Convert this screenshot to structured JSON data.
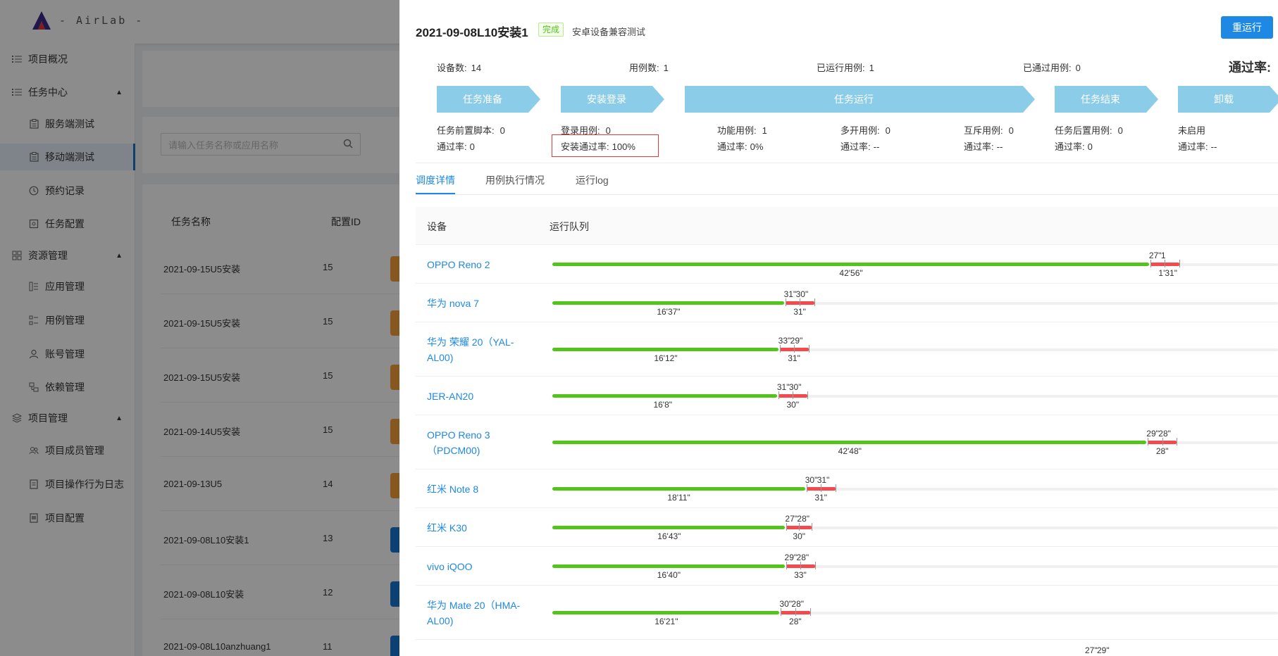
{
  "app": {
    "logo_text": "- AirLab -"
  },
  "sidebar": {
    "items": [
      {
        "label": "项目概况",
        "icon": "list-icon",
        "type": "group"
      },
      {
        "label": "任务中心",
        "icon": "list-icon",
        "type": "group",
        "expanded": true
      },
      {
        "label": "服务端测试",
        "icon": "clipboard-icon",
        "type": "sub"
      },
      {
        "label": "移动端测试",
        "icon": "clipboard-icon",
        "type": "sub",
        "active": true
      },
      {
        "label": "预约记录",
        "icon": "clock-icon",
        "type": "sub"
      },
      {
        "label": "任务配置",
        "icon": "config-icon",
        "type": "sub"
      },
      {
        "label": "资源管理",
        "icon": "grid-icon",
        "type": "group",
        "expanded": true
      },
      {
        "label": "应用管理",
        "icon": "app-icon",
        "type": "sub"
      },
      {
        "label": "用例管理",
        "icon": "case-icon",
        "type": "sub"
      },
      {
        "label": "账号管理",
        "icon": "user-icon",
        "type": "sub"
      },
      {
        "label": "依赖管理",
        "icon": "dependency-icon",
        "type": "sub"
      },
      {
        "label": "项目管理",
        "icon": "layers-icon",
        "type": "group",
        "expanded": true
      },
      {
        "label": "项目成员管理",
        "icon": "team-icon",
        "type": "sub"
      },
      {
        "label": "项目操作行为日志",
        "icon": "log-icon",
        "type": "sub"
      },
      {
        "label": "项目配置",
        "icon": "doc-icon",
        "type": "sub"
      }
    ]
  },
  "background": {
    "search_placeholder": "请输入任务名称或应用名称",
    "col_task_name": "任务名称",
    "col_config_id": "配置ID",
    "rows": [
      {
        "name": "2021-09-15U5安装",
        "config_id": "15"
      },
      {
        "name": "2021-09-15U5安装",
        "config_id": "15"
      },
      {
        "name": "2021-09-15U5安装",
        "config_id": "15"
      },
      {
        "name": "2021-09-14U5安装",
        "config_id": "15"
      },
      {
        "name": "2021-09-13U5",
        "config_id": "14"
      },
      {
        "name": "2021-09-08L10安装1",
        "config_id": "13"
      },
      {
        "name": "2021-09-08L10安装",
        "config_id": "12"
      },
      {
        "name": "2021-09-08L10anzhuang1",
        "config_id": "11"
      }
    ]
  },
  "drawer": {
    "title": "2021-09-08L10安装1",
    "status_badge": "完成",
    "subtitle": "安卓设备兼容测试",
    "rerun_button": "重运行",
    "stats": {
      "devices_label": "设备数:",
      "devices_value": "14",
      "cases_label": "用例数:",
      "cases_value": "1",
      "run_cases_label": "已运行用例:",
      "run_cases_value": "1",
      "passed_cases_label": "已通过用例:",
      "passed_cases_value": "0",
      "pass_rate_label": "通过率:"
    },
    "stages": [
      {
        "label": "任务准备"
      },
      {
        "label": "安装登录"
      },
      {
        "label": "任务运行"
      },
      {
        "label": "任务结束"
      },
      {
        "label": "卸载"
      }
    ],
    "stage_details": {
      "prep_script_label": "任务前置脚本:",
      "prep_script_value": "0",
      "prep_rate_label": "通过率:",
      "prep_rate_value": "0",
      "login_case_label": "登录用例:",
      "login_case_value": "0",
      "install_rate_label": "安装通过率:",
      "install_rate_value": "100%",
      "func_case_label": "功能用例:",
      "func_case_value": "1",
      "func_rate_label": "通过率:",
      "func_rate_value": "0%",
      "multi_case_label": "多开用例:",
      "multi_case_value": "0",
      "multi_rate_label": "通过率:",
      "multi_rate_value": "--",
      "mutex_case_label": "互斥用例:",
      "mutex_case_value": "0",
      "mutex_rate_label": "通过率:",
      "mutex_rate_value": "--",
      "post_case_label": "任务后置用例:",
      "post_case_value": "0",
      "post_rate_label": "通过率:",
      "post_rate_value": "0",
      "uninstall_status": "未启用",
      "uninstall_rate_label": "通过率:",
      "uninstall_rate_value": "--"
    },
    "tabs": [
      {
        "label": "调度详情",
        "active": true
      },
      {
        "label": "用例执行情况"
      },
      {
        "label": "运行log"
      }
    ],
    "table": {
      "col_device": "设备",
      "col_queue": "运行队列",
      "colors": {
        "run": "#52c41a",
        "install": "#f5494d",
        "device_link": "#1e88e5"
      },
      "devices": [
        {
          "name": "OPPO Reno 2",
          "green_fraction": 0.956,
          "main_time": "42'56\"",
          "top_labels": [
            "27\"",
            "1"
          ],
          "bottom_label": "1'31\"",
          "red_fraction": 0.04
        },
        {
          "name": "华为 nova 7",
          "green_fraction": 0.371,
          "main_time": "16'37\"",
          "top_labels": [
            "31\"",
            "30\""
          ],
          "bottom_label": "31\"",
          "red_fraction": 0.04
        },
        {
          "name": "华为 荣耀 20（YAL-AL00)",
          "green_fraction": 0.362,
          "main_time": "16'12\"",
          "top_labels": [
            "33\"",
            "29\""
          ],
          "bottom_label": "31\"",
          "red_fraction": 0.04
        },
        {
          "name": "JER-AN20",
          "green_fraction": 0.36,
          "main_time": "16'8\"",
          "top_labels": [
            "31\"",
            "30\""
          ],
          "bottom_label": "30\"",
          "red_fraction": 0.04
        },
        {
          "name": "OPPO Reno 3（PDCM00)",
          "green_fraction": 0.952,
          "main_time": "42'48\"",
          "top_labels": [
            "29\"",
            "28\""
          ],
          "bottom_label": "28\"",
          "red_fraction": 0.04
        },
        {
          "name": "红米 Note 8",
          "green_fraction": 0.405,
          "main_time": "18'11\"",
          "top_labels": [
            "30\"",
            "31\""
          ],
          "bottom_label": "31\"",
          "red_fraction": 0.04
        },
        {
          "name": "红米 K30",
          "green_fraction": 0.373,
          "main_time": "16'43\"",
          "top_labels": [
            "27\"",
            "28\""
          ],
          "bottom_label": "30\"",
          "red_fraction": 0.035
        },
        {
          "name": "vivo iQOO",
          "green_fraction": 0.372,
          "main_time": "16'40\"",
          "top_labels": [
            "29\"",
            "28\""
          ],
          "bottom_label": "33\"",
          "red_fraction": 0.04
        },
        {
          "name": "华为 Mate 20（HMA-AL00)",
          "green_fraction": 0.364,
          "main_time": "16'21\"",
          "top_labels": [
            "30\"",
            "28\""
          ],
          "bottom_label": "28\"",
          "red_fraction": 0.04
        },
        {
          "name": "",
          "green_fraction": 0.0,
          "main_time": "",
          "top_labels": [
            "27\"",
            "29\""
          ],
          "bottom_label": "",
          "red_fraction": 0.0
        }
      ]
    }
  }
}
